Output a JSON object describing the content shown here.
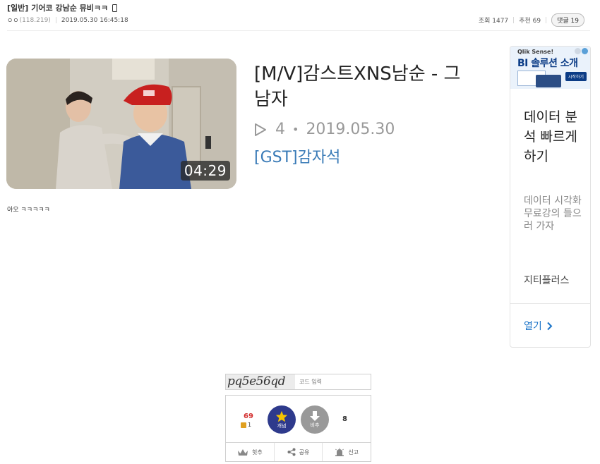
{
  "post": {
    "category": "[일반]",
    "title": "기어코 강남순 뮤비ㅋㅋ",
    "author": "ㅇㅇ",
    "author_ip": "(118.219)",
    "datetime": "2019.05.30 16:45:18",
    "views_label": "조회 1477",
    "recommend_label": "추천 69",
    "replies_label": "댓글 19",
    "body": "아오 ㅋㅋㅋㅋㅋ"
  },
  "video": {
    "title": "[M/V]감스트XNS남순 - 그 남자",
    "duration": "04:29",
    "plays": "4",
    "separator": "•",
    "date": "2019.05.30",
    "channel": "[GST]감자석"
  },
  "ad": {
    "brand": "Qlik Sense!",
    "headline": "BI 솔루션 소개",
    "cta": "시작하기",
    "heading": "데이터 분석 빠르게 하기",
    "body": "데이터 시각화 무료강의 들으러 가자",
    "sponsor": "지티플러스",
    "open_label": "열기"
  },
  "captcha": {
    "code": "pq5e56qd",
    "placeholder": "코드 입력"
  },
  "recommend": {
    "up_count": "69",
    "fix_count": "1",
    "up_label": "개념",
    "down_label": "비추",
    "down_count": "8",
    "hit_label": "힛추",
    "share_label": "공유",
    "report_label": "신고"
  },
  "colors": {
    "channel_link": "#3a7bb7",
    "up_button": "#2e3a8c",
    "down_button": "#999999",
    "up_count": "#d32f2f",
    "ad_link": "#1a73c8"
  },
  "icons": [
    "mobile-icon",
    "play-icon",
    "star-icon",
    "arrow-down-icon",
    "crown-icon",
    "share-icon",
    "siren-icon",
    "chevron-right-icon",
    "fix-icon"
  ]
}
